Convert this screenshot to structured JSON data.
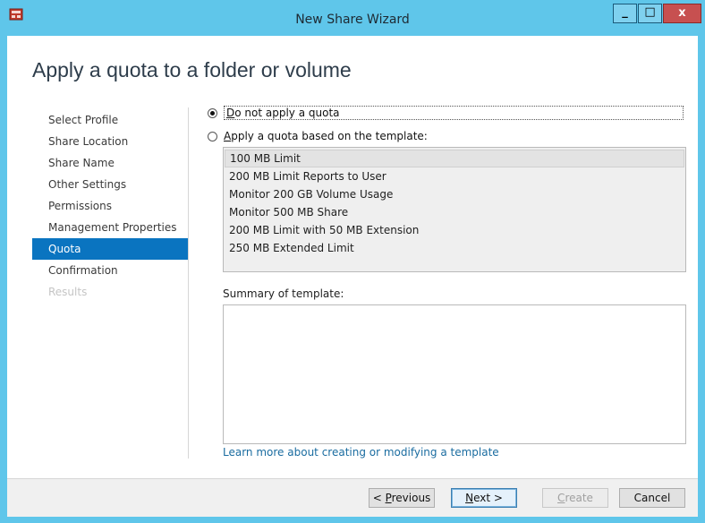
{
  "window": {
    "title": "New Share Wizard",
    "icon": "share-wizard-icon",
    "controls": {
      "minimize": "_",
      "maximize": "□",
      "close": "x"
    }
  },
  "page": {
    "heading": "Apply a quota to a folder or volume"
  },
  "nav": {
    "items": [
      {
        "label": "Select Profile",
        "state": "normal"
      },
      {
        "label": "Share Location",
        "state": "normal"
      },
      {
        "label": "Share Name",
        "state": "normal"
      },
      {
        "label": "Other Settings",
        "state": "normal"
      },
      {
        "label": "Permissions",
        "state": "normal"
      },
      {
        "label": "Management Properties",
        "state": "normal"
      },
      {
        "label": "Quota",
        "state": "active"
      },
      {
        "label": "Confirmation",
        "state": "normal"
      },
      {
        "label": "Results",
        "state": "disabled"
      }
    ]
  },
  "options": {
    "no_quota": {
      "accesskey": "D",
      "rest": "o not apply a quota",
      "checked": true
    },
    "template_quota": {
      "accesskey": "A",
      "rest": "pply a quota based on the template:",
      "checked": false
    }
  },
  "templates": {
    "items": [
      "100 MB Limit",
      "200 MB Limit Reports to User",
      "Monitor 200 GB Volume Usage",
      "Monitor 500 MB Share",
      "200 MB Limit with 50 MB Extension",
      "250 MB Extended Limit"
    ],
    "selected_index": 0
  },
  "summary": {
    "label": "Summary of template:",
    "content": ""
  },
  "link": {
    "text": "Learn more about creating or modifying a template"
  },
  "buttons": {
    "previous": {
      "prefix": "< ",
      "accesskey": "P",
      "rest": "revious"
    },
    "next": {
      "accesskey": "N",
      "rest": "ext >"
    },
    "create": {
      "accesskey": "C",
      "rest": "reate"
    },
    "cancel": {
      "label": "Cancel"
    }
  },
  "colors": {
    "title_bar": "#5fc6ea",
    "nav_active": "#0a74c0",
    "link": "#1a6ca0",
    "close_button": "#c75050"
  }
}
